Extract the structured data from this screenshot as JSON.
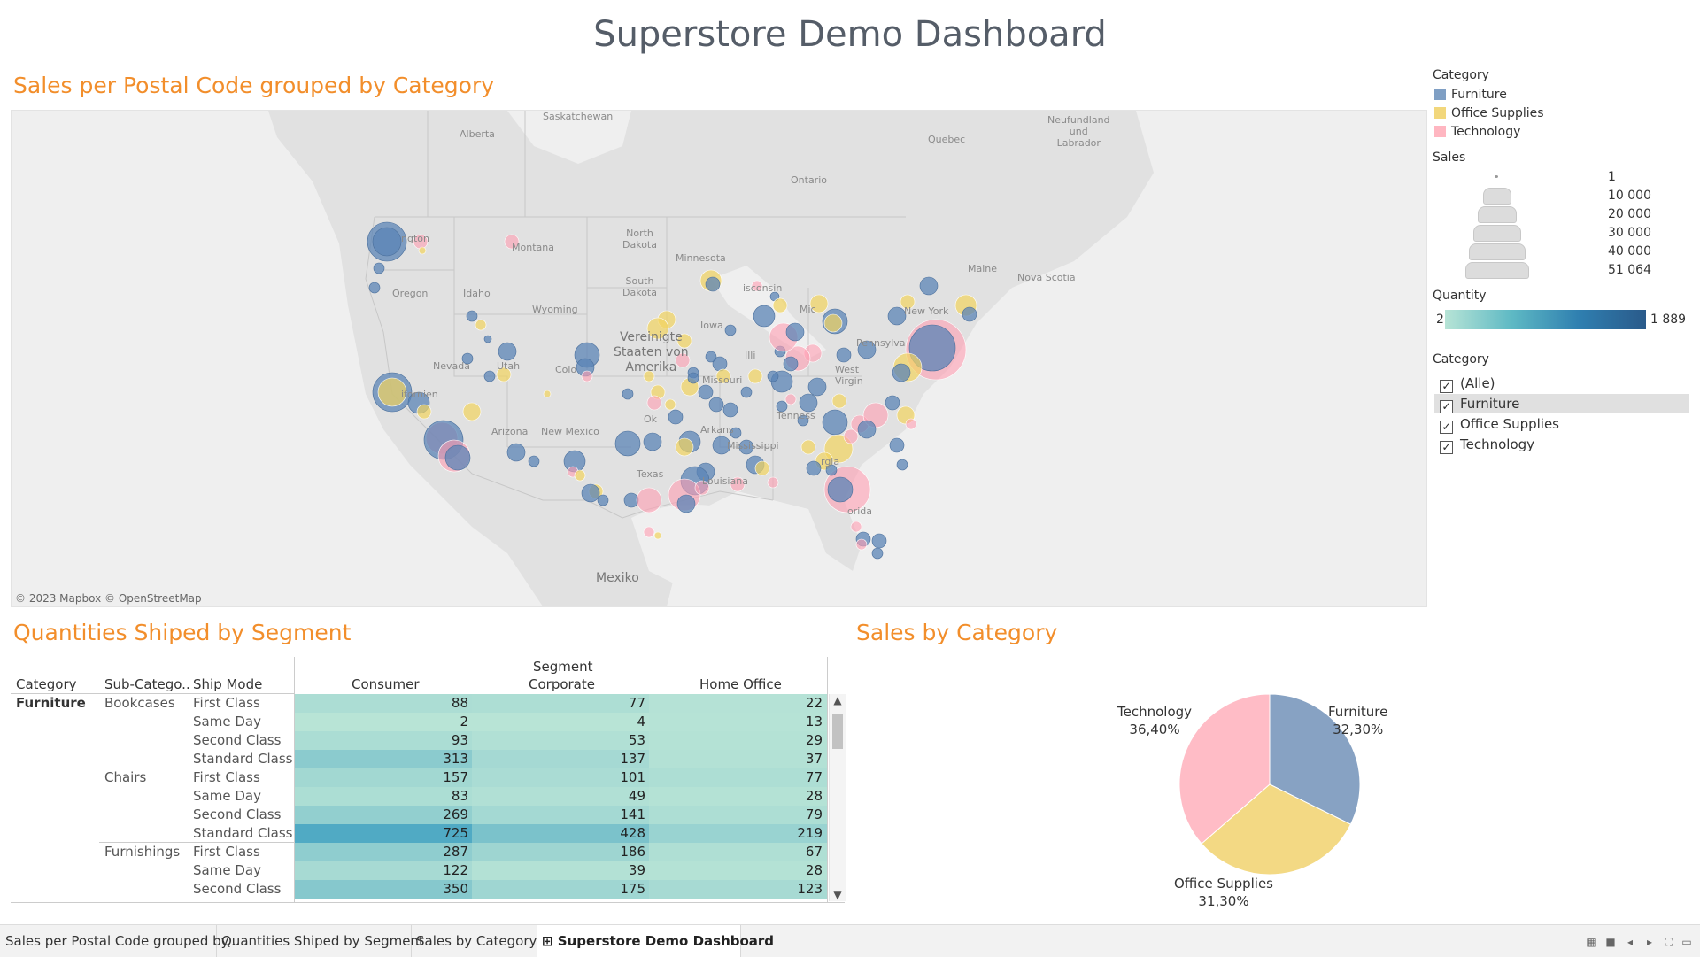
{
  "title": "Superstore Demo Dashboard",
  "map": {
    "title": "Sales per Postal Code grouped by Category",
    "attribution": "© 2023 Mapbox © OpenStreetMap",
    "labels": {
      "saskatchewan": "Saskatchewan",
      "alberta": "Alberta",
      "quebec": "Quebec",
      "newfoundland": "Neufundland\nund\nLabrador",
      "ontario": "Ontario",
      "north_dakota": "North\nDakota",
      "minnesota": "Minnesota",
      "montana": "Montana",
      "washington": "ngton",
      "south_dakota": "South\nDakota",
      "wisconsin": "isconsin",
      "maine": "Maine",
      "nova_scotia": "Nova Scotia",
      "oregon": "Oregon",
      "idaho": "Idaho",
      "wyoming": "Wyoming",
      "michigan": "Mic",
      "new_york": "New York",
      "country": "Vereinigte\nStaaten von\nAmerika",
      "iowa": "Iowa",
      "illinois": "Illi",
      "pennsylvania": "Pennsylva",
      "nevada": "Nevada",
      "utah": "Utah",
      "colorado": "Colo",
      "missouri": "Missouri",
      "west_virginia": "West\nVirgin",
      "california": "ifornien",
      "oklahoma": "Ok",
      "tennessee": "Tenness",
      "arizona": "Arizona",
      "new_mexico": "New Mexico",
      "arkansas": "Arkans",
      "mississippi": "Mississippi",
      "texas": "Texas",
      "louisiana": "Louisiana",
      "georgia": "rgia",
      "florida": "orida",
      "mexico": "Mexiko"
    }
  },
  "legend": {
    "category_title": "Category",
    "categories": [
      {
        "label": "Furniture",
        "color": "#7f9fc4"
      },
      {
        "label": "Office Supplies",
        "color": "#f2d77c"
      },
      {
        "label": "Technology",
        "color": "#ffb6c1"
      }
    ],
    "sales_title": "Sales",
    "sales_sizes": [
      "1",
      "10 000",
      "20 000",
      "30 000",
      "40 000",
      "51 064"
    ],
    "quantity_title": "Quantity",
    "quantity_min": "2",
    "quantity_max": "1 889",
    "filter_title": "Category",
    "filter_items": [
      {
        "label": "(Alle)",
        "checked": true,
        "selected": false
      },
      {
        "label": "Furniture",
        "checked": true,
        "selected": true
      },
      {
        "label": "Office Supplies",
        "checked": true,
        "selected": false
      },
      {
        "label": "Technology",
        "checked": true,
        "selected": false
      }
    ]
  },
  "table": {
    "title": "Quantities Shiped by Segment",
    "headers": {
      "category": "Category",
      "subcategory": "Sub-Catego..",
      "shipmode": "Ship Mode",
      "segment": "Segment",
      "consumer": "Consumer",
      "corporate": "Corporate",
      "home_office": "Home Office"
    },
    "category": "Furniture",
    "groups": [
      {
        "sub": "Bookcases",
        "rows": [
          {
            "mode": "First Class",
            "consumer": 88,
            "corporate": 77,
            "home": 22
          },
          {
            "mode": "Same Day",
            "consumer": 2,
            "corporate": 4,
            "home": 13
          },
          {
            "mode": "Second Class",
            "consumer": 93,
            "corporate": 53,
            "home": 29
          },
          {
            "mode": "Standard Class",
            "consumer": 313,
            "corporate": 137,
            "home": 37
          }
        ]
      },
      {
        "sub": "Chairs",
        "rows": [
          {
            "mode": "First Class",
            "consumer": 157,
            "corporate": 101,
            "home": 77
          },
          {
            "mode": "Same Day",
            "consumer": 83,
            "corporate": 49,
            "home": 28
          },
          {
            "mode": "Second Class",
            "consumer": 269,
            "corporate": 141,
            "home": 79
          },
          {
            "mode": "Standard Class",
            "consumer": 725,
            "corporate": 428,
            "home": 219
          }
        ]
      },
      {
        "sub": "Furnishings",
        "rows": [
          {
            "mode": "First Class",
            "consumer": 287,
            "corporate": 186,
            "home": 67
          },
          {
            "mode": "Same Day",
            "consumer": 122,
            "corporate": 39,
            "home": 28
          },
          {
            "mode": "Second Class",
            "consumer": 350,
            "corporate": 175,
            "home": 123
          }
        ]
      }
    ]
  },
  "pie": {
    "title": "Sales by Category",
    "slices": [
      {
        "label": "Furniture",
        "pct": "32,30%",
        "value": 32.3,
        "color": "#87a2c3"
      },
      {
        "label": "Office Supplies",
        "pct": "31,30%",
        "value": 31.3,
        "color": "#f3d984"
      },
      {
        "label": "Technology",
        "pct": "36,40%",
        "value": 36.4,
        "color": "#ffbcc6"
      }
    ]
  },
  "chart_data": {
    "type": "pie",
    "title": "Sales by Category",
    "categories": [
      "Furniture",
      "Office Supplies",
      "Technology"
    ],
    "values": [
      32.3,
      31.3,
      36.4
    ]
  },
  "tabs": [
    {
      "label": "Sales per Postal Code grouped by...",
      "active": false
    },
    {
      "label": "Quantities Shiped by Segment",
      "active": false
    },
    {
      "label": "Sales by Category",
      "active": false
    },
    {
      "label": "Superstore Demo Dashboard",
      "active": true
    }
  ]
}
